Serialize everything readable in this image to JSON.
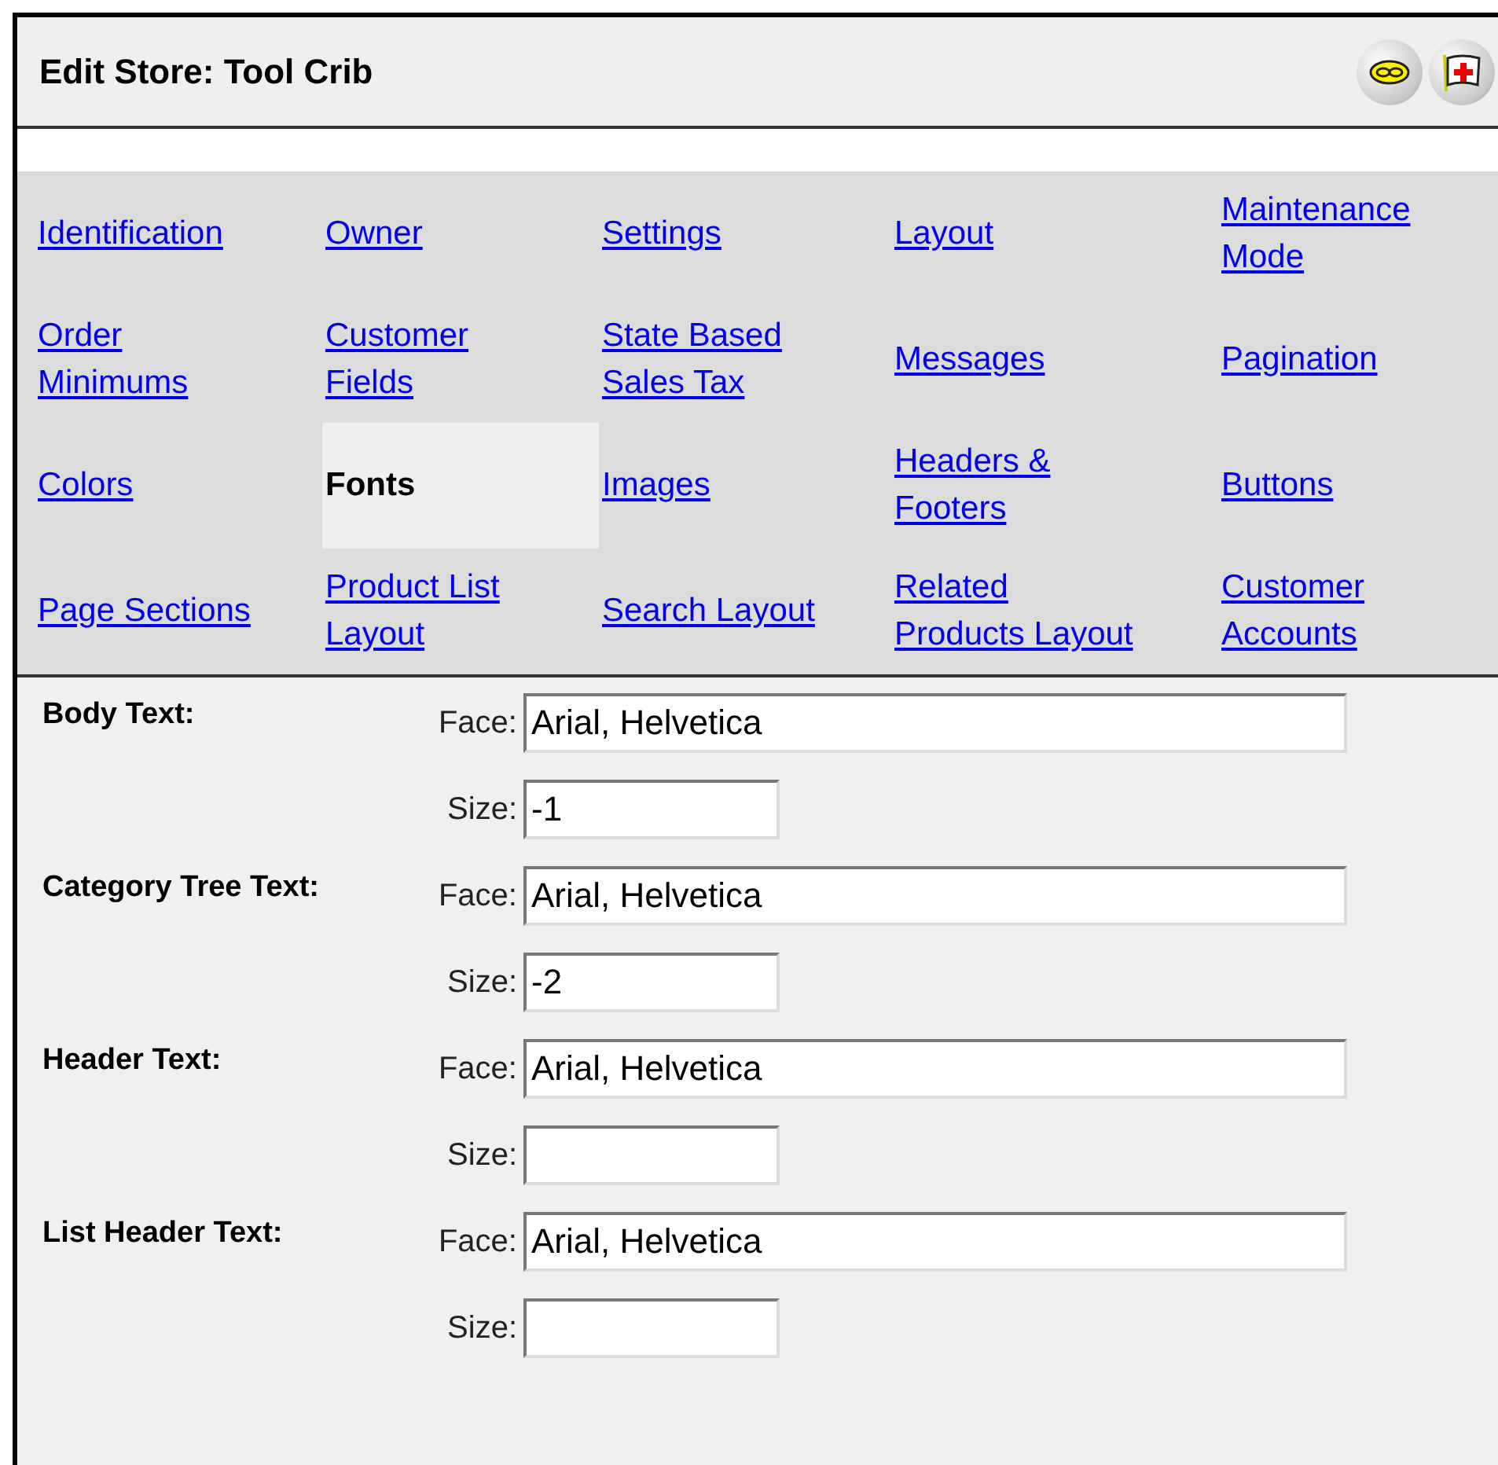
{
  "header": {
    "title": "Edit Store: Tool Crib"
  },
  "nav": [
    {
      "label": "Identification",
      "selected": false
    },
    {
      "label": "Owner",
      "selected": false
    },
    {
      "label": "Settings",
      "selected": false
    },
    {
      "label": "Layout",
      "selected": false
    },
    {
      "label": "Maintenance Mode",
      "selected": false
    },
    {
      "label": "Order Minimums",
      "selected": false
    },
    {
      "label": "Customer Fields",
      "selected": false
    },
    {
      "label": "State Based Sales Tax",
      "selected": false
    },
    {
      "label": "Messages",
      "selected": false
    },
    {
      "label": "Pagination",
      "selected": false
    },
    {
      "label": "Colors",
      "selected": false
    },
    {
      "label": "Fonts",
      "selected": true
    },
    {
      "label": "Images",
      "selected": false
    },
    {
      "label": "Headers & Footers",
      "selected": false
    },
    {
      "label": "Buttons",
      "selected": false
    },
    {
      "label": "Page Sections",
      "selected": false
    },
    {
      "label": "Product List Layout",
      "selected": false
    },
    {
      "label": "Search Layout",
      "selected": false
    },
    {
      "label": "Related Products Layout",
      "selected": false
    },
    {
      "label": "Customer Accounts",
      "selected": false
    }
  ],
  "sections": [
    {
      "label": "Body Text:",
      "face_label": "Face:",
      "face": "Arial, Helvetica",
      "size_label": "Size:",
      "size": "-1"
    },
    {
      "label": "Category Tree Text:",
      "face_label": "Face:",
      "face": "Arial, Helvetica",
      "size_label": "Size:",
      "size": "-2"
    },
    {
      "label": "Header Text:",
      "face_label": "Face:",
      "face": "Arial, Helvetica",
      "size_label": "Size:"
    },
    {
      "label": "List Header Text:",
      "face_label": "Face:",
      "face": "Arial, Helvetica",
      "size_label": "Size:"
    }
  ]
}
